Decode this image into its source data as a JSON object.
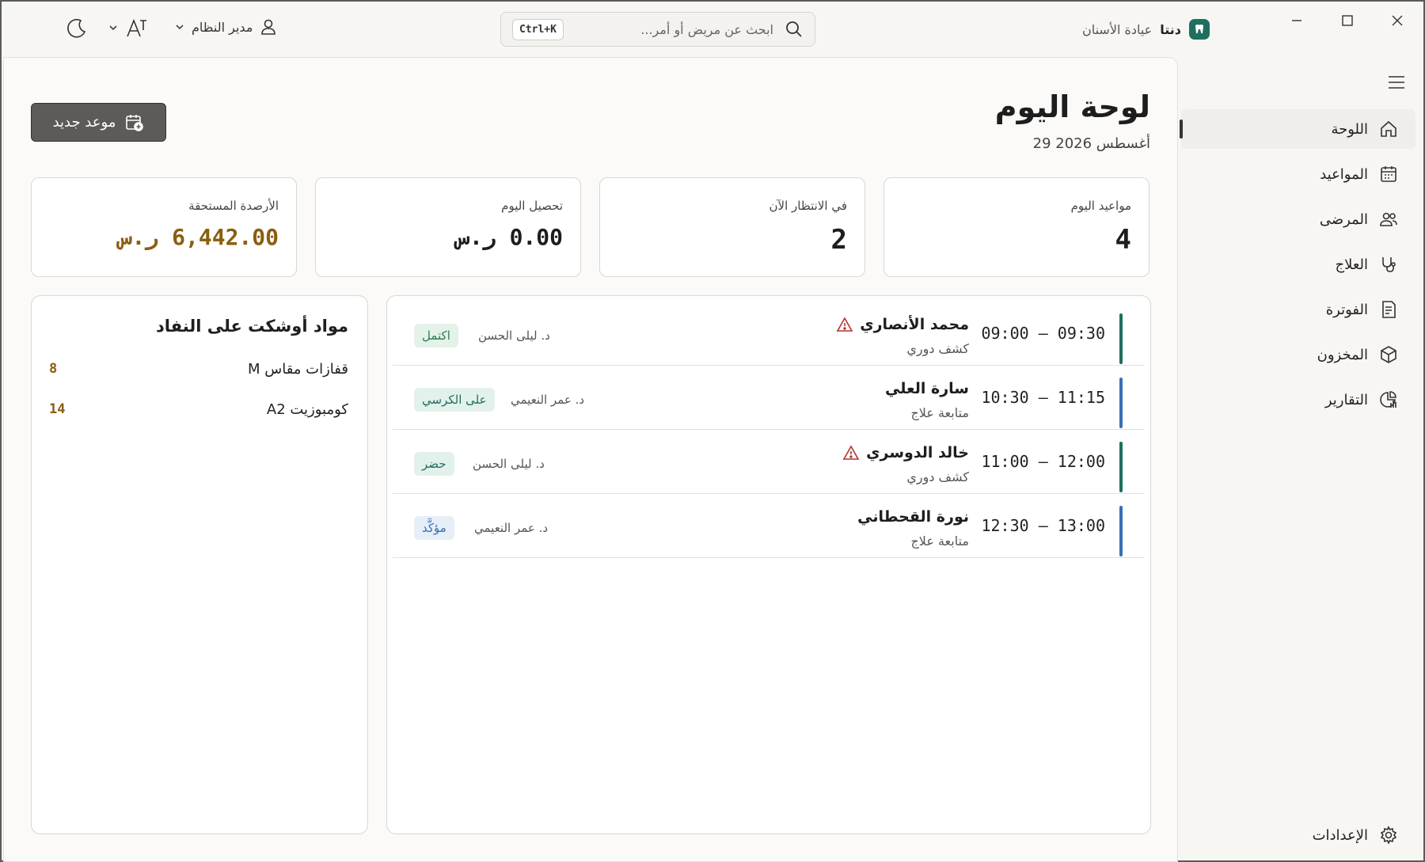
{
  "app": {
    "name": "دنتا",
    "subtitle": "عيادة الأسنان"
  },
  "search": {
    "placeholder": "ابحث عن مريض أو أمر...",
    "shortcut": "Ctrl+K"
  },
  "user": {
    "role": "مدير النظام"
  },
  "page": {
    "title": "لوحة اليوم",
    "date": "29 أغسطس 2026",
    "new_button": "موعد جديد"
  },
  "stats": [
    {
      "label": "مواعيد اليوم",
      "value": "4"
    },
    {
      "label": "في الانتظار الآن",
      "value": "2"
    },
    {
      "label": "تحصيل اليوم",
      "value": "0.00 ر.س"
    },
    {
      "label": "الأرصدة المستحقة",
      "value": "6,442.00 ر.س"
    }
  ],
  "appointments": [
    {
      "time": "09:00 – 09:30",
      "patient": "محمد الأنصاري",
      "type": "كشف دوري",
      "doctor": "د. ليلى الحسن",
      "status": "اكتمل",
      "alert": true
    },
    {
      "time": "10:30 – 11:15",
      "patient": "سارة العلي",
      "type": "متابعة علاج",
      "doctor": "د. عمر النعيمي",
      "status": "على الكرسي",
      "alert": false
    },
    {
      "time": "11:00 – 12:00",
      "patient": "خالد الدوسري",
      "type": "كشف دوري",
      "doctor": "د. ليلى الحسن",
      "status": "حضر",
      "alert": true
    },
    {
      "time": "12:30 – 13:00",
      "patient": "نورة القحطاني",
      "type": "متابعة علاج",
      "doctor": "د. عمر النعيمي",
      "status": "مؤكَّد",
      "alert": false
    }
  ],
  "low_stock": {
    "title": "مواد أوشكت على النفاد",
    "items": [
      {
        "name": "قفازات مقاس M",
        "qty": "8"
      },
      {
        "name": "كومبوزيت A2",
        "qty": "14"
      }
    ]
  },
  "nav": {
    "items": [
      {
        "label": "اللوحة",
        "icon": "home-icon"
      },
      {
        "label": "المواعيد",
        "icon": "calendar-icon"
      },
      {
        "label": "المرضى",
        "icon": "users-icon"
      },
      {
        "label": "العلاج",
        "icon": "stethoscope-icon"
      },
      {
        "label": "الفوترة",
        "icon": "invoice-icon"
      },
      {
        "label": "المخزون",
        "icon": "box-icon"
      },
      {
        "label": "التقارير",
        "icon": "chart-icon"
      }
    ],
    "settings": "الإعدادات"
  },
  "colors": {
    "accent_teal": "#1e6f5f",
    "accent_blue": "#3a6fb3",
    "gold": "#8a5e10",
    "alert_red": "#b3342b"
  }
}
